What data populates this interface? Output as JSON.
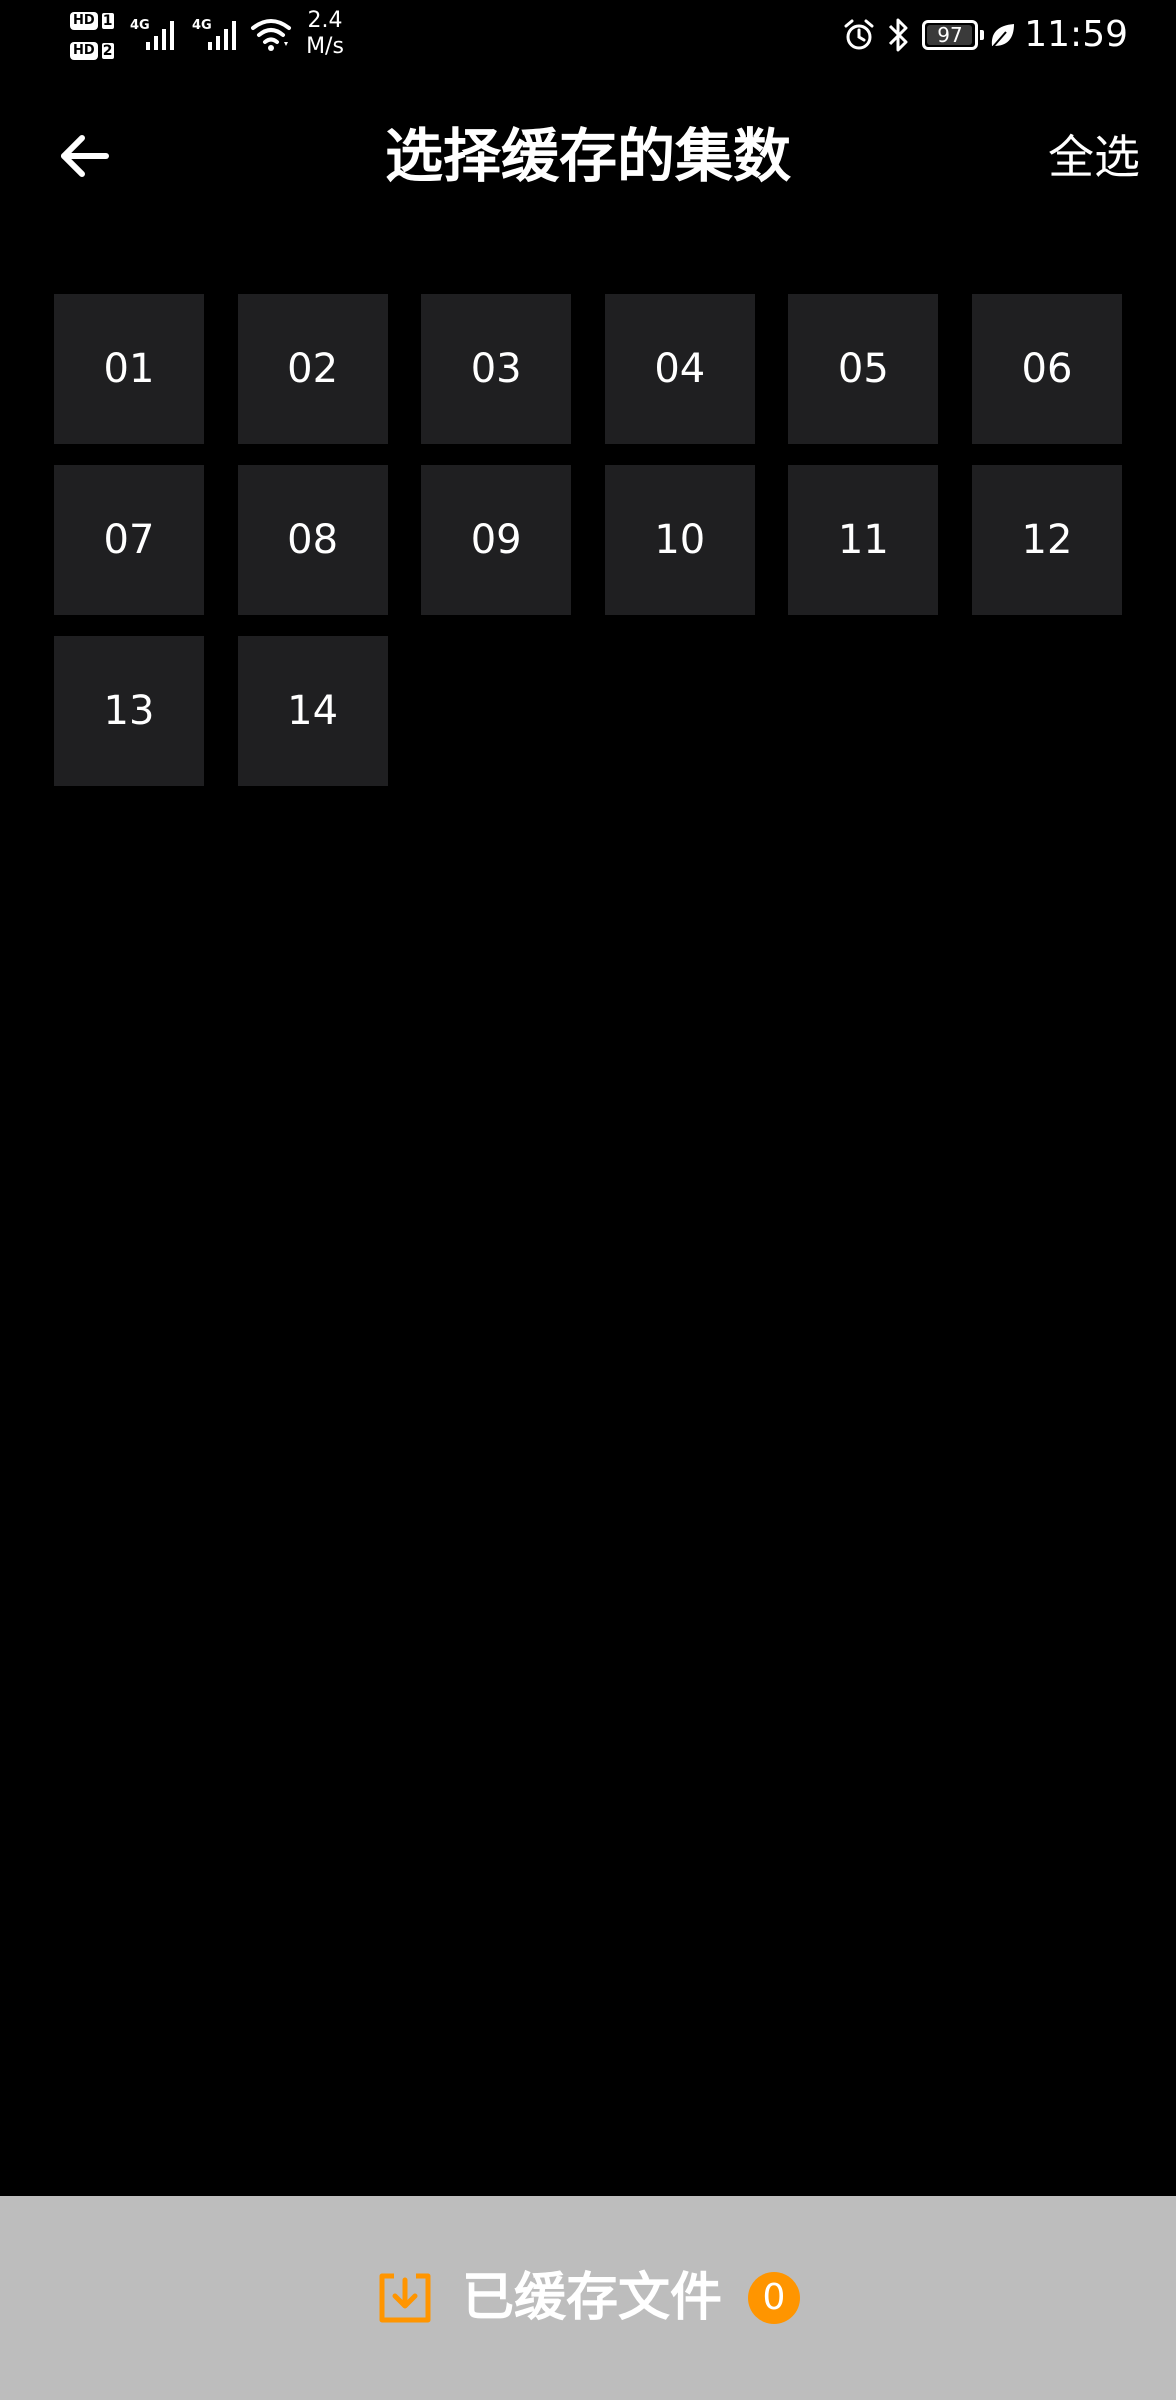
{
  "status_bar": {
    "sim1_label": "HD",
    "sim1_num": "1",
    "sim2_label": "HD",
    "sim2_num": "2",
    "network_type_1": "4G",
    "network_type_2": "4G",
    "net_speed_value": "2.4",
    "net_speed_unit": "M/s",
    "battery_level": "97",
    "battery_fraction": 0.97,
    "time": "11:59",
    "icons": [
      "alarm-icon",
      "bluetooth-icon",
      "battery-icon",
      "leaf-icon",
      "wifi-icon",
      "signal-icon"
    ]
  },
  "header": {
    "title": "选择缓存的集数",
    "select_all_label": "全选",
    "back_icon": "arrow-left-icon"
  },
  "episodes": [
    "01",
    "02",
    "03",
    "04",
    "05",
    "06",
    "07",
    "08",
    "09",
    "10",
    "11",
    "12",
    "13",
    "14"
  ],
  "bottom_bar": {
    "label": "已缓存文件",
    "count": "0",
    "icon": "download-icon",
    "accent_color": "#ff9500",
    "background_color": "#bdbdbd"
  },
  "colors": {
    "background": "#000000",
    "cell_background": "#1f1f21",
    "text": "#ffffff"
  }
}
